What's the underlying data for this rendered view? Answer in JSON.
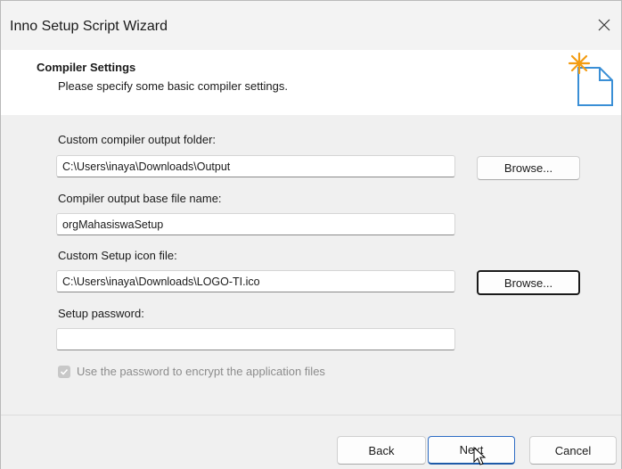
{
  "window": {
    "title": "Inno Setup Script Wizard"
  },
  "header": {
    "title": "Compiler Settings",
    "subtitle": "Please specify some basic compiler settings.",
    "icon": "wizard-new-file-icon"
  },
  "form": {
    "output_folder": {
      "label": "Custom compiler output folder:",
      "value": "C:\\Users\\inaya\\Downloads\\Output",
      "browse_label": "Browse..."
    },
    "base_file_name": {
      "label": "Compiler output base file name:",
      "value": "orgMahasiswaSetup"
    },
    "icon_file": {
      "label": "Custom Setup icon file:",
      "value": "C:\\Users\\inaya\\Downloads\\LOGO-TI.ico",
      "browse_label": "Browse..."
    },
    "password": {
      "label": "Setup password:",
      "value": ""
    },
    "encrypt": {
      "label": "Use the password to encrypt the application files",
      "checked": true,
      "disabled": true
    }
  },
  "footer": {
    "back_label": "Back",
    "next_label": "Next",
    "cancel_label": "Cancel"
  },
  "colors": {
    "accent": "#2d6cc4",
    "icon_star": "#f39c12",
    "icon_outline": "#3a8fd6"
  }
}
